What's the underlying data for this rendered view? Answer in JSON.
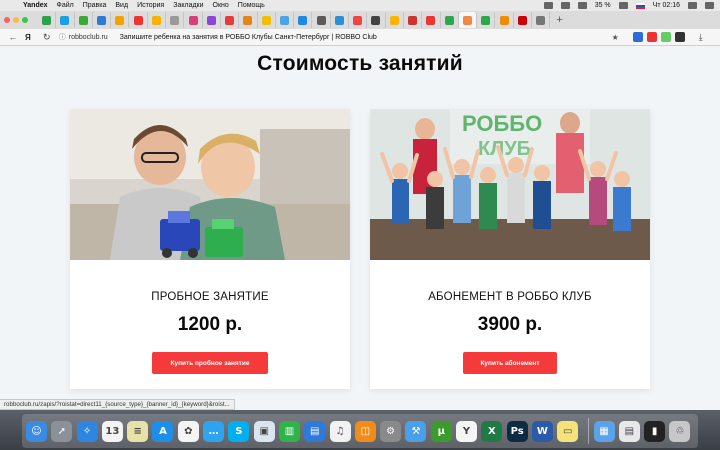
{
  "menubar": {
    "app": "Yandex",
    "items": [
      "Файл",
      "Правка",
      "Вид",
      "История",
      "Закладки",
      "Окно",
      "Помощь"
    ],
    "battery": "35 %",
    "clock": "Чт 02:16"
  },
  "browser": {
    "tab_icon_colors": [
      "#2ca24c",
      "#1aa1e1",
      "#3aa93a",
      "#2e7bd6",
      "#f3a300",
      "#e33",
      "#fab400",
      "#9a9a9a",
      "#d6407b",
      "#8a48d8",
      "#e23d3d",
      "#e8831a",
      "#f0c000",
      "#48a6e6",
      "#1e88e5",
      "#5a5a5a",
      "#2d8fd6",
      "#e44",
      "#444",
      "#ffb300",
      "#c33",
      "#e33",
      "#2fa64e",
      "#e84",
      "#2aa84a",
      "#f08c00",
      "#c00",
      "#777"
    ],
    "active_tab_index": 23,
    "back_icon": "back-arrow-icon",
    "refresh_icon": "refresh-icon",
    "browser_logo": "Я",
    "domain": "robboclub.ru",
    "page_title": "Запишите ребенка на занятия в РОББО Клубы Санкт-Петербург | ROBBO Club",
    "extension_colors": [
      "#2d6bd6",
      "#e33",
      "#6c6",
      "#333"
    ],
    "download_icon": "download-icon"
  },
  "page": {
    "heading": "Стоимость занятий",
    "cards": [
      {
        "image": "boys-building-robot-photo",
        "title": "ПРОБНОЕ ЗАНЯТИЕ",
        "price": "1200 р.",
        "button": "Купить пробное занятие"
      },
      {
        "image": "robbo-club-group-photo",
        "title": "АБОНЕМЕНТ В РОББО КЛУБ",
        "price": "3900 р.",
        "button": "Купить абонемент"
      }
    ]
  },
  "status_url": "robboclub.ru/zapis/?roistat=direct11_{source_type}_{banner_id}_{keyword}&roist...",
  "dock": {
    "apps": [
      {
        "name": "finder-icon",
        "color": "#3b8be0",
        "glyph": "☺"
      },
      {
        "name": "launchpad-icon",
        "color": "#8a9199",
        "glyph": "➚"
      },
      {
        "name": "safari-icon",
        "color": "#2f86e0",
        "glyph": "✧"
      },
      {
        "name": "calendar-icon",
        "color": "#f4f4f4",
        "glyph": "13"
      },
      {
        "name": "notes-icon",
        "color": "#e9e2a8",
        "glyph": "≡"
      },
      {
        "name": "app-store-icon",
        "color": "#1e8fe8",
        "glyph": "A"
      },
      {
        "name": "photos-icon",
        "color": "#f5f5f5",
        "glyph": "✿"
      },
      {
        "name": "messages-icon",
        "color": "#2ea3ef",
        "glyph": "…"
      },
      {
        "name": "skype-icon",
        "color": "#00aff0",
        "glyph": "S"
      },
      {
        "name": "preview-icon",
        "color": "#d9e5ef",
        "glyph": "▣"
      },
      {
        "name": "numbers-icon",
        "color": "#2fb34a",
        "glyph": "▥"
      },
      {
        "name": "keynote-icon",
        "color": "#2f7ad9",
        "glyph": "▤"
      },
      {
        "name": "itunes-icon",
        "color": "#f2f2f2",
        "glyph": "♫"
      },
      {
        "name": "ibooks-icon",
        "color": "#f08c1a",
        "glyph": "◫"
      },
      {
        "name": "system-preferences-icon",
        "color": "#8a8a8a",
        "glyph": "⚙"
      },
      {
        "name": "xcode-icon",
        "color": "#4aa0e8",
        "glyph": "⚒"
      },
      {
        "name": "utorrent-icon",
        "color": "#3d9a2e",
        "glyph": "μ"
      },
      {
        "name": "yandex-browser-icon",
        "color": "#f5f5f5",
        "glyph": "Y"
      },
      {
        "name": "excel-icon",
        "color": "#1f7a43",
        "glyph": "X"
      },
      {
        "name": "photoshop-icon",
        "color": "#0d2b45",
        "glyph": "Ps"
      },
      {
        "name": "word-icon",
        "color": "#2a5aa8",
        "glyph": "W"
      },
      {
        "name": "stickies-icon",
        "color": "#f5e27a",
        "glyph": "▭"
      }
    ],
    "right_items": [
      {
        "name": "downloads-folder-icon",
        "color": "#5ba3e8",
        "glyph": "▦"
      },
      {
        "name": "documents-stack-icon",
        "color": "#e8e8e8",
        "glyph": "▤"
      },
      {
        "name": "trash-icon",
        "color": "#c7c7c7",
        "glyph": "♲"
      }
    ],
    "terminal_color": "#222"
  }
}
